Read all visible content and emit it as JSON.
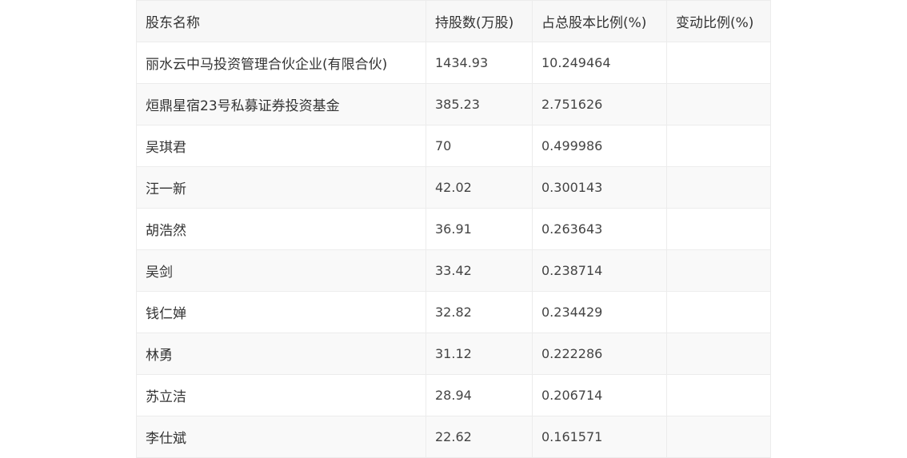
{
  "table": {
    "headers": [
      "股东名称",
      "持股数(万股)",
      "占总股本比例(%)",
      "变动比例(%)"
    ],
    "rows": [
      [
        "丽水云中马投资管理合伙企业(有限合伙)",
        "1434.93",
        "10.249464",
        ""
      ],
      [
        "烜鼎星宿23号私募证券投资基金",
        "385.23",
        "2.751626",
        ""
      ],
      [
        "吴琪君",
        "70",
        "0.499986",
        ""
      ],
      [
        "汪一新",
        "42.02",
        "0.300143",
        ""
      ],
      [
        "胡浩然",
        "36.91",
        "0.263643",
        ""
      ],
      [
        "吴剑",
        "33.42",
        "0.238714",
        ""
      ],
      [
        "钱仁婵",
        "32.82",
        "0.234429",
        ""
      ],
      [
        "林勇",
        "31.12",
        "0.222286",
        ""
      ],
      [
        "苏立洁",
        "28.94",
        "0.206714",
        ""
      ],
      [
        "李仕斌",
        "22.62",
        "0.161571",
        ""
      ]
    ]
  }
}
